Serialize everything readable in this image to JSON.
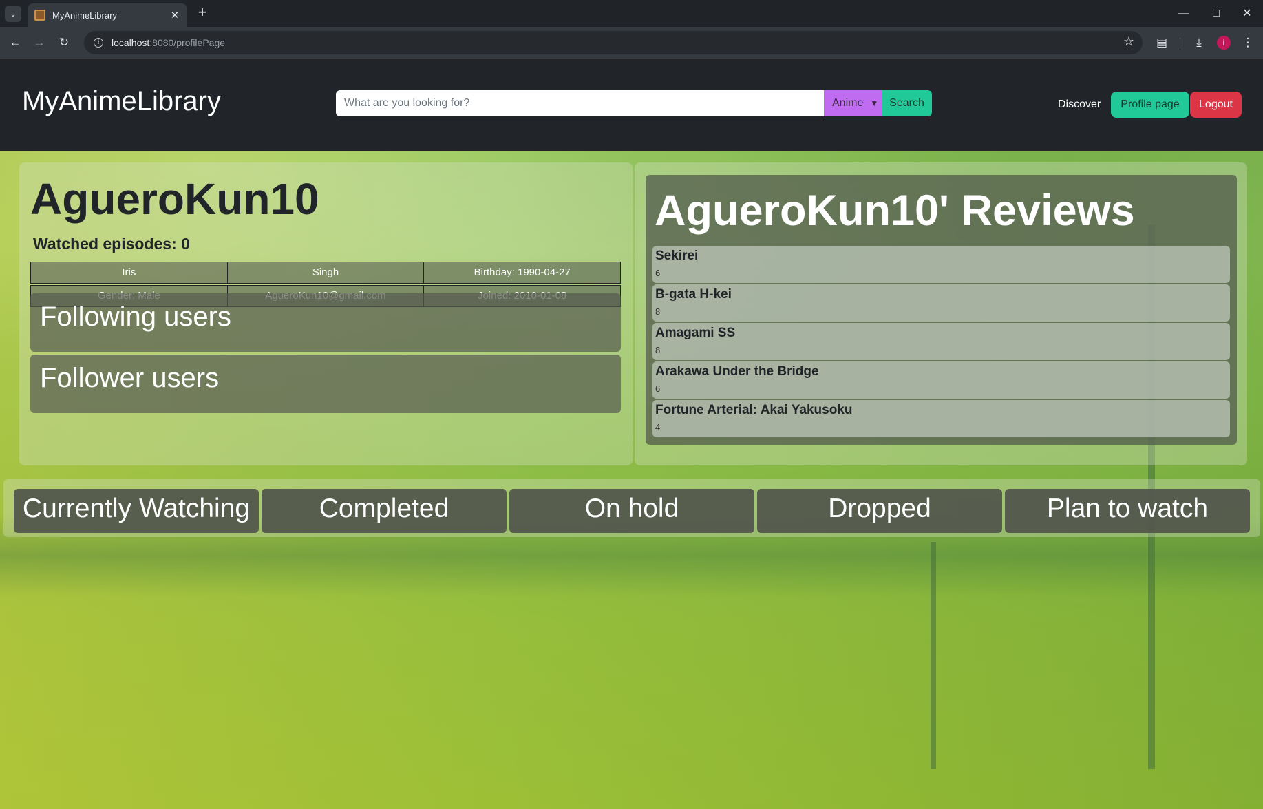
{
  "browser": {
    "tab_title": "MyAnimeLibrary",
    "url_host": "localhost",
    "url_rest": ":8080/profilePage",
    "avatar_letter": "i"
  },
  "navbar": {
    "brand": "MyAnimeLibrary",
    "search_placeholder": "What are you looking for?",
    "category": "Anime",
    "search_label": "Search",
    "discover_label": "Discover",
    "profile_label": "Profile page",
    "logout_label": "Logout"
  },
  "profile": {
    "username": "AgueroKun10",
    "watched_episodes": "Watched episodes: 0",
    "first_name": "Iris",
    "last_name": "Singh",
    "birthday": "Birthday: 1990-04-27",
    "gender": "Gender: Male",
    "email": "AgueroKun10@gmail.com",
    "joined": "Joined: 2010-01-08",
    "following_label": "Following users",
    "follower_label": "Follower users"
  },
  "reviews": {
    "title": "AgueroKun10' Reviews",
    "items": [
      {
        "name": "Sekirei",
        "score": "6"
      },
      {
        "name": "B-gata H-kei",
        "score": "8"
      },
      {
        "name": "Amagami SS",
        "score": "8"
      },
      {
        "name": "Arakawa Under the Bridge",
        "score": "6"
      },
      {
        "name": "Fortune Arterial: Akai Yakusoku",
        "score": "4"
      }
    ]
  },
  "lists": [
    "Currently Watching",
    "Completed",
    "On hold",
    "Dropped",
    "Plan to watch"
  ],
  "colors": {
    "navbar": "#212529",
    "accent": "#20c997",
    "category": "#c06cf0",
    "danger": "#dc3545"
  }
}
